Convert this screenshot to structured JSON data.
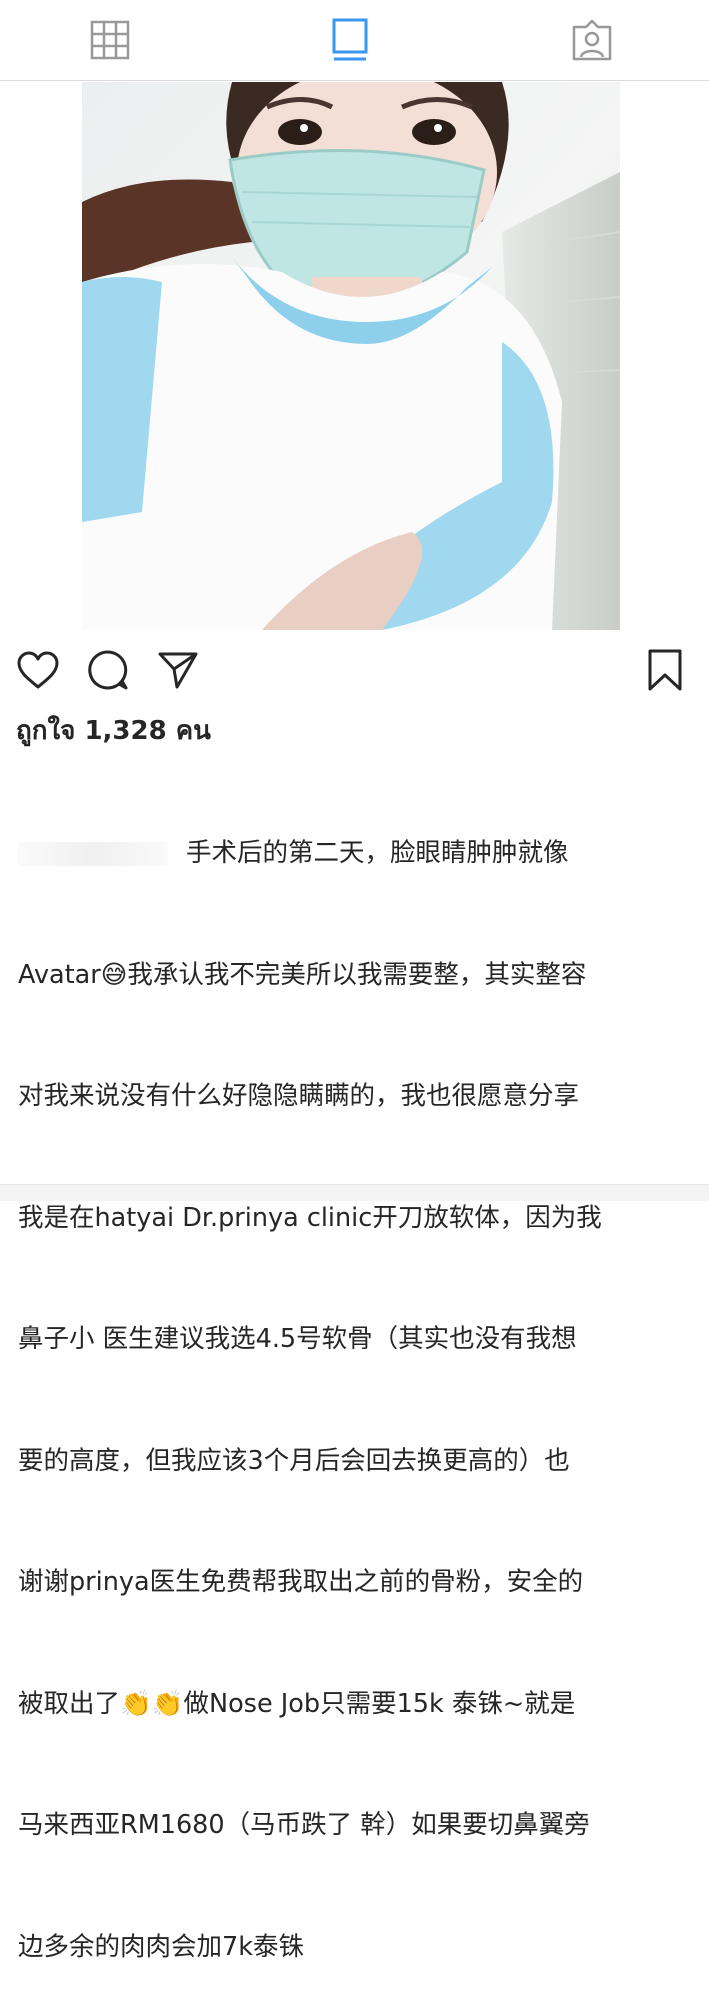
{
  "tabs": {
    "grid": "grid-icon",
    "feed": "feed-icon",
    "tagged": "tagged-icon"
  },
  "post": {
    "likes_text": "ถูกใจ 1,328 คน",
    "caption_lines": [
      "手术后的第二天，脸眼睛肿肿就像",
      "Avatar😅我承认我不完美所以我需要整，其实整容",
      "对我来说没有什么好隐隐瞒瞒的，我也很愿意分享",
      "我是在hatyai Dr.prinya clinic开刀放软体，因为我",
      "鼻子小 医生建议我选4.5号软骨（其实也没有我想",
      "要的高度，但我应该3个月后会回去换更高的）也",
      "谢谢prinya医生免费帮我取出之前的骨粉，安全的",
      "被取出了👏👏做Nose Job只需要15k 泰铢~就是",
      "马来西亚RM1680（马币跌了 幹）如果要切鼻翼旁",
      "边多余的肉肉会加7k泰铢"
    ]
  },
  "icons": {
    "like": "heart-icon",
    "comment": "comment-icon",
    "share": "send-icon",
    "save": "bookmark-icon"
  },
  "colors": {
    "accent": "#3897f0",
    "icon": "#262626",
    "inactive": "#999999"
  }
}
